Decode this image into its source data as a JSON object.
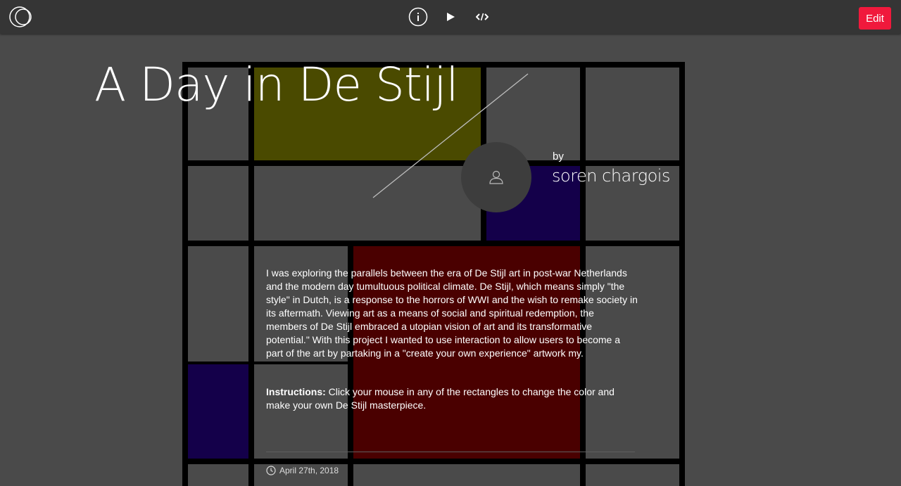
{
  "toolbar": {
    "logo_icon": "openprocessing-logo-icon",
    "info_icon": "info-icon",
    "play_icon": "play-icon",
    "code_icon": "code-icon",
    "edit_label": "Edit",
    "edit_color": "#f0193c"
  },
  "sketch": {
    "title": "A Day in De Stijl",
    "by_label": "by",
    "author": "soren chargois",
    "avatar_icon": "user-icon",
    "description": "I was exploring the parallels between the era of De Stijl art in post-war Netherlands and the modern day tumultuous political climate. De Stijl, which means simply \"the style\" in Dutch, is a response to the horrors of WWI and the wish to remake society in its aftermath. Viewing art as a means of social and spiritual redemption, the members of De Stijl embraced a utopian vision of art and its transformative potential.\" With this project I wanted to use interaction to allow users to become a part of the art by partaking in a \"create your own experience\" artwork my.",
    "instructions_label": "Instructions:",
    "instructions_text": " Click your mouse in any of the rectangles to change the color and make your own De Stijl masterpiece.",
    "date_icon": "clock-icon",
    "date": "April 27th, 2018"
  },
  "palette": {
    "background": "#4a4a4a",
    "grid_lines": "#000000",
    "yellow": "#4a4a00",
    "blue": "#14004a",
    "red": "#4a0000"
  }
}
